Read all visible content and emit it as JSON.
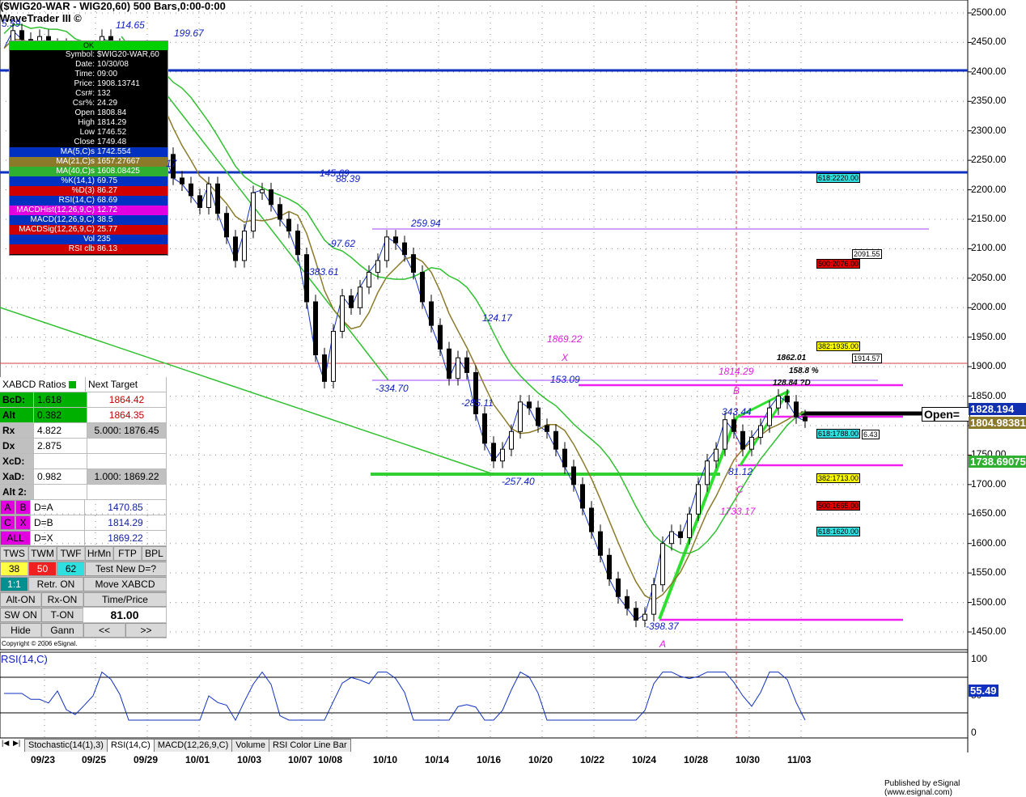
{
  "title": "($WIG20-WAR - WIG20,60) 500 Bars,0:00-0:00",
  "subtitle": "WaveTrader III ©",
  "copyright": "Copyright © 2006 eSignal.",
  "published": "Published by eSignal (www.esignal.com)",
  "info_panel": {
    "ok": "OK",
    "rows": [
      {
        "k": "Symbol:",
        "v": "$WIG20-WAR,60",
        "bg": "#000"
      },
      {
        "k": "Date:",
        "v": "10/30/08",
        "bg": "#000"
      },
      {
        "k": "Time:",
        "v": "09:00",
        "bg": "#000"
      },
      {
        "k": "Price:",
        "v": "1908.13741",
        "bg": "#000"
      },
      {
        "k": "Csr#:",
        "v": "132",
        "bg": "#000"
      },
      {
        "k": "Csr%:",
        "v": "24.29",
        "bg": "#000"
      },
      {
        "k": "Open",
        "v": "1808.84",
        "bg": "#000"
      },
      {
        "k": "High",
        "v": "1814.29",
        "bg": "#000"
      },
      {
        "k": "Low",
        "v": "1746.52",
        "bg": "#000"
      },
      {
        "k": "Close",
        "v": "1749.48",
        "bg": "#000"
      },
      {
        "k": "MA(5,C)s",
        "v": "1742.554",
        "bg": "#0030c0"
      },
      {
        "k": "MA(21,C)s",
        "v": "1657.27667",
        "bg": "#8b7a2a"
      },
      {
        "k": "MA(40,C)s",
        "v": "1608.08425",
        "bg": "#30b030"
      },
      {
        "k": "%K(14,1)",
        "v": "69.75",
        "bg": "#0030c0"
      },
      {
        "k": "%D(3)",
        "v": "86.27",
        "bg": "#d00000"
      },
      {
        "k": "RSI(14,C)",
        "v": "68.69",
        "bg": "#0030c0"
      },
      {
        "k": "MACDHist(12,26,9,C)",
        "v": "12.72",
        "bg": "#e000e0"
      },
      {
        "k": "MACD(12,26,9,C)",
        "v": "38.5",
        "bg": "#0030c0"
      },
      {
        "k": "MACDSig(12,26,9,C)",
        "v": "25.77",
        "bg": "#d00000"
      },
      {
        "k": "Vol",
        "v": "235",
        "bg": "#0030c0"
      },
      {
        "k": "RSI clb",
        "v": "86.13",
        "bg": "#d00000"
      }
    ]
  },
  "xabcd": {
    "header": "XABCD Ratios",
    "next_target": "Next Target",
    "rows": [
      {
        "k": "BcD:",
        "v": "1.618",
        "t": "1864.42"
      },
      {
        "k": "Alt",
        "v": "0.382",
        "t": "1864.35"
      },
      {
        "k": "Rx",
        "v": "4.822",
        "t": "5.000: 1876.45"
      },
      {
        "k": "Dx",
        "v": "2.875",
        "t": ""
      },
      {
        "k": "XcD:",
        "v": "",
        "t": ""
      },
      {
        "k": "XaD:",
        "v": "0.982",
        "t": "1.000: 1869.22"
      },
      {
        "k": "Alt 2:",
        "v": "",
        "t": ""
      }
    ],
    "pairs": [
      {
        "a": "A",
        "b": "B",
        "eq": "D=A",
        "val": "1470.85"
      },
      {
        "a": "C",
        "b": "X",
        "eq": "D=B",
        "val": "1814.29"
      },
      {
        "a": "ALL",
        "b": "",
        "eq": "D=X",
        "val": "1869.22"
      }
    ],
    "buttons": {
      "tws": "TWS",
      "twm": "TWM",
      "twf": "TWF",
      "hrmn": "HrMn",
      "ftp": "FTP",
      "bpl": "BPL",
      "n38": "38",
      "n50": "50",
      "n62": "62",
      "test": "Test New D=?",
      "one": "1:1",
      "retr": "Retr. ON",
      "move": "Move XABCD",
      "alt": "Alt-ON",
      "rx": "Rx-ON",
      "tp": "Time/Price",
      "sw": "SW ON",
      "ton": "T-ON",
      "val": "81.00",
      "hide": "Hide",
      "gann": "Gann",
      "prev": "<<",
      "next": ">>"
    }
  },
  "tabs": [
    "Stochastic(14(1),3)",
    "RSI(14,C)",
    "MACD(12,26,9,C)",
    "Volume",
    "RSI Color Line Bar"
  ],
  "rsi_label": "RSI(14,C)",
  "open_label": "Open=",
  "chart_data": {
    "type": "line",
    "title": "($WIG20-WAR - WIG20,60) 500 Bars,0:00-0:00",
    "ylim": [
      1420,
      2510
    ],
    "yticks": [
      "2500.00",
      "2450.00",
      "2400.00",
      "2350.00",
      "2300.00",
      "2250.00",
      "2200.00",
      "2150.00",
      "2100.00",
      "2050.00",
      "2000.00",
      "1950.00",
      "1900.00",
      "1850.00",
      "1800.00",
      "1750.00",
      "1700.00",
      "1650.00",
      "1600.00",
      "1550.00",
      "1500.00",
      "1450.00"
    ],
    "xticks": [
      "09/23",
      "09/25",
      "09/29",
      "10/01",
      "10/03",
      "10/07",
      "10/08",
      "10/10",
      "10/14",
      "10/16",
      "10/20",
      "10/22",
      "10/24",
      "10/28",
      "10/30",
      "11/03"
    ],
    "price_series": [
      2440,
      2470,
      2455,
      2430,
      2460,
      2430,
      2445,
      2420,
      2330,
      2380,
      2420,
      2460,
      2445,
      2425,
      2390,
      2340,
      2330,
      2290,
      2260,
      2220,
      2210,
      2190,
      2170,
      2210,
      2160,
      2120,
      2080,
      2130,
      2195,
      2200,
      2175,
      2150,
      2130,
      2090,
      2010,
      1920,
      1875,
      1960,
      2020,
      2000,
      2035,
      2060,
      2080,
      2120,
      2110,
      2090,
      2060,
      2010,
      1970,
      1930,
      1880,
      1915,
      1890,
      1820,
      1770,
      1740,
      1760,
      1790,
      1840,
      1830,
      1800,
      1790,
      1760,
      1730,
      1700,
      1660,
      1620,
      1580,
      1540,
      1510,
      1490,
      1470,
      1480,
      1530,
      1600,
      1620,
      1610,
      1650,
      1700,
      1740,
      1760,
      1810,
      1790,
      1760,
      1780,
      1800,
      1830,
      1850,
      1840,
      1815,
      1808
    ],
    "rsi": {
      "ylim": [
        0,
        100
      ],
      "yticks": [
        "100",
        "50",
        "0"
      ],
      "last": "55.49"
    },
    "price_labels": [
      {
        "t": "114.65"
      },
      {
        "t": "199.67"
      },
      {
        "t": "145.69"
      },
      {
        "t": "88.39"
      },
      {
        "t": "-97.62"
      },
      {
        "t": "-383.61"
      },
      {
        "t": "259.94"
      },
      {
        "t": "124.17"
      },
      {
        "t": "-334.70"
      },
      {
        "t": "-285.11"
      },
      {
        "t": "153.09"
      },
      {
        "t": "-257.40"
      },
      {
        "t": "-398.37"
      },
      {
        "t": "343.44"
      },
      {
        "t": "81.12"
      },
      {
        "t": "1869.22"
      },
      {
        "t": "1814.29"
      },
      {
        "t": "1733.17"
      },
      {
        "t": "1862.01"
      },
      {
        "t": "158.8 %"
      },
      {
        "t": "128.84 ?D"
      },
      {
        "t": "5.59"
      },
      {
        "t": "17"
      }
    ],
    "points": [
      "X",
      "B",
      "C",
      "A"
    ],
    "fib_boxes": [
      {
        "t": "618:2220.00",
        "bg": "#30e0e0"
      },
      {
        "t": "2091.55",
        "bg": "#fff"
      },
      {
        "t": "500:2076.00",
        "bg": "#e00000"
      },
      {
        "t": "382:1935.00",
        "bg": "#ffff00"
      },
      {
        "t": "1914.57",
        "bg": "#fff"
      },
      {
        "t": "618:1788.00",
        "bg": "#30e0e0"
      },
      {
        "t": "6.43",
        "bg": "#fff"
      },
      {
        "t": "382:1713.00",
        "bg": "#ffff00"
      },
      {
        "t": "500:1665.00",
        "bg": "#e00000"
      },
      {
        "t": "618:1620.00",
        "bg": "#30e0e0"
      }
    ],
    "price_tags": [
      {
        "t": "1828.194",
        "bg": "#1030b0"
      },
      {
        "t": "1804.98381",
        "bg": "#8b7a2a"
      },
      {
        "t": "1738.69075",
        "bg": "#30b030"
      }
    ]
  }
}
